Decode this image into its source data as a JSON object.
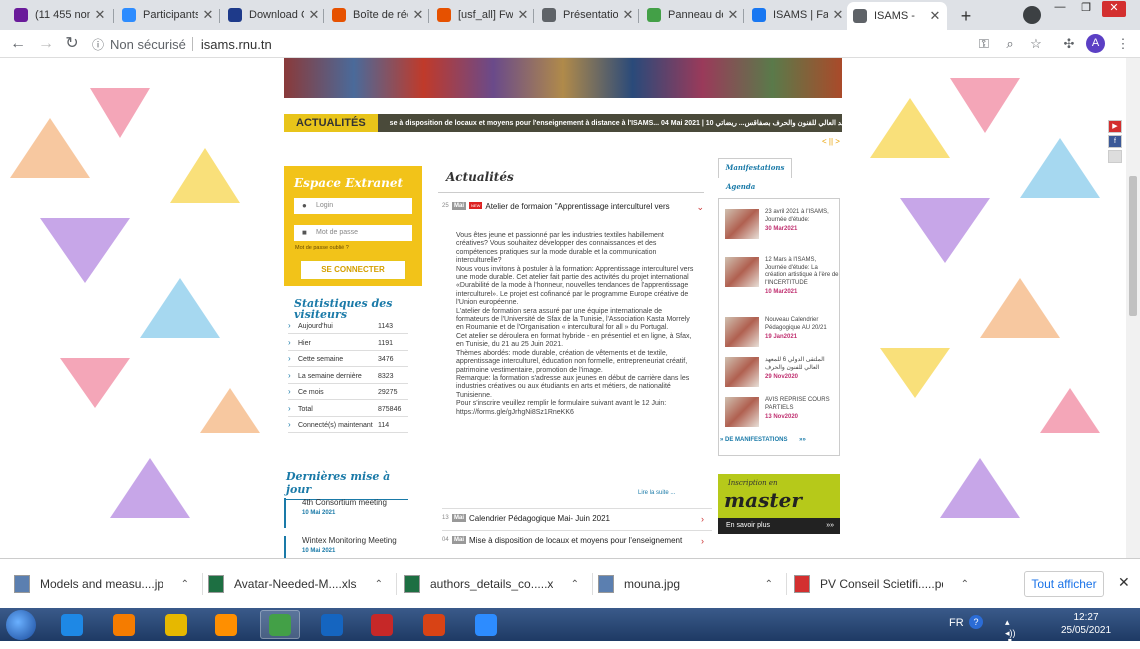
{
  "browser": {
    "tabs": [
      {
        "label": "(11 455 non lus)",
        "icon_color": "#6a1b9a",
        "active": false
      },
      {
        "label": "Participants",
        "icon_color": "#2d8cff",
        "active": false
      },
      {
        "label": "Download Ce",
        "icon_color": "#1e3a8a",
        "active": false
      },
      {
        "label": "Boîte de réception",
        "icon_color": "#e65100",
        "active": false
      },
      {
        "label": "[usf_all] Fwd",
        "icon_color": "#e65100",
        "active": false
      },
      {
        "label": "Présentation",
        "icon_color": "#5f6368",
        "active": false
      },
      {
        "label": "Panneau de",
        "icon_color": "#43a047",
        "active": false
      },
      {
        "label": "ISAMS | Face",
        "icon_color": "#1877f2",
        "active": false
      },
      {
        "label": "ISAMS -",
        "icon_color": "#5f6368",
        "active": true
      }
    ],
    "not_secure": "Non sécurisé",
    "url": "isams.rnu.tn",
    "profile_initial": "A"
  },
  "site": {
    "news_label": "ACTUALITÉS",
    "news_ticker": "se à disposition de locaux et moyens pour l'enseignement à distance à l'ISAMS...  04 Mai 2021   |   10  بالمعهد العالي للفنون والحرف بصفاقس... ريضاتي",
    "pager": "< || >",
    "extranet": {
      "title": "Espace Extranet",
      "login_placeholder": "Login",
      "password_placeholder": "Mot de passe",
      "forgot": "Mot de passe oublié ?",
      "connect": "SE CONNECTER"
    },
    "stats": {
      "title": "Statistiques des visiteurs",
      "rows": [
        {
          "label": "Aujourd'hui",
          "value": "1143"
        },
        {
          "label": "Hier",
          "value": "1191"
        },
        {
          "label": "Cette semaine",
          "value": "3476"
        },
        {
          "label": "La semaine dernière",
          "value": "8323"
        },
        {
          "label": "Ce mois",
          "value": "29275"
        },
        {
          "label": "Total",
          "value": "875846"
        },
        {
          "label": "Connecté(s) maintenant",
          "value": "114"
        }
      ]
    },
    "last_updates": {
      "title": "Dernières mise à jour",
      "items": [
        {
          "title": "4th Consortium meeting",
          "date": "10 Mai 2021"
        },
        {
          "title": "Wintex Monitoring Meeting",
          "date": "10 Mai 2021"
        }
      ]
    },
    "actualites": {
      "title": "Actualités",
      "items": [
        {
          "day": "25",
          "month": "Mai",
          "new": "NEW",
          "title": "Atelier de formaion \"Apprentissage interculturel vers"
        },
        {
          "day": "13",
          "month": "Mai",
          "title": "Calendrier Pédagogique Mai- Juin 2021"
        },
        {
          "day": "04",
          "month": "Mai",
          "title": "Mise à disposition de locaux et moyens pour l'enseignement"
        }
      ],
      "article": [
        "Vous êtes jeune et passionné par les industries textiles habillement créatives? Vous souhaitez développer des connaissances et des compétences pratiques sur la mode durable et la communication interculturelle?",
        "Nous vous invitons à postuler à la formation: Apprentissage interculturel vers une mode durable. Cet atelier fait partie des activités du projet international «Durabilité de la mode à l'honneur, nouvelles tendances de l'apprentissage interculturel». Le projet est cofinancé par le programme Europe créative de l'Union européenne.",
        "L'atelier de formation sera assuré par une équipe internationale de formateurs de l'Université de Sfax de la Tunisie, l'Association Kasta Morrely en Roumanie et de l'Organisation « intercultural for all » du Portugal.",
        "Cet atelier se déroulera en format hybride - en présentiel et en ligne, à Sfax, en Tunisie, du 21 au 25 Juin 2021.",
        "Thèmes abordés: mode durable, création de vêtements et de textile, apprentissage interculturel, éducation non formelle, entrepreneuriat créatif, patrimoine vestimentaire, promotion de l'image.",
        "Remarque: la formation s'adresse aux jeunes en début de carrière dans les industries  créatives ou aux étudiants en arts et métiers, de nationalité Tunisienne.",
        "Pour s'inscrire veuillez remplir le formulaire suivant avant le 12 Juin: https://forms.gle/gJrhgNi8Sz1RneKK6"
      ],
      "read_more": "Lire la suite ..."
    },
    "agenda": {
      "tab_manifestations": "Manifestations",
      "tab_agenda": "Agenda",
      "events": [
        {
          "title": "23 avril 2021 à l'ISAMS, Journée d'étude:",
          "date": "30 Mar2021"
        },
        {
          "title": "12 Mars à l'ISAMS, Journée d'étude: La création artistique à l'ère de l'INCERTITUDE",
          "date": "10 Mar2021"
        },
        {
          "title": "Nouveau Calendrier Pédagogique AU 20/21",
          "date": "19 Jan2021"
        },
        {
          "title": "الملتقى الدولي 6 للمعهد العالي للفنون والحرف",
          "date": "29 Nov2020"
        },
        {
          "title": "AVIS REPRISE COURS PARTIELS",
          "date": "13 Nov2020"
        }
      ],
      "more": "» DE MANIFESTATIONS",
      "more_arrows": "»»"
    },
    "master": {
      "line1": "Inscription en",
      "line2": "master",
      "cta": "En savoir plus",
      "cta_arrows": "»»"
    }
  },
  "downloads": {
    "items": [
      {
        "name": "Models and measu....jpg",
        "color": "#5b7fb0"
      },
      {
        "name": "Avatar-Needed-M....xlsx",
        "color": "#1d6f42"
      },
      {
        "name": "authors_details_co.....xlsx",
        "color": "#1d6f42"
      },
      {
        "name": "mouna.jpg",
        "color": "#5b7fb0"
      },
      {
        "name": "PV Conseil Scietifi.....pdf",
        "color": "#d32f2f"
      }
    ],
    "show_all": "Tout afficher"
  },
  "taskbar": {
    "apps": [
      {
        "name": "ie",
        "color": "#1e88e5"
      },
      {
        "name": "paint",
        "color": "#f57c00"
      },
      {
        "name": "explorer",
        "color": "#e6b800"
      },
      {
        "name": "media",
        "color": "#ff8f00"
      },
      {
        "name": "chrome",
        "color": "#43a047"
      },
      {
        "name": "word",
        "color": "#1565c0"
      },
      {
        "name": "acrobat",
        "color": "#c62828"
      },
      {
        "name": "powerpoint",
        "color": "#d84315"
      },
      {
        "name": "zoom",
        "color": "#2d8cff"
      }
    ],
    "lang": "FR",
    "time": "12:27",
    "date": "25/05/2021"
  }
}
